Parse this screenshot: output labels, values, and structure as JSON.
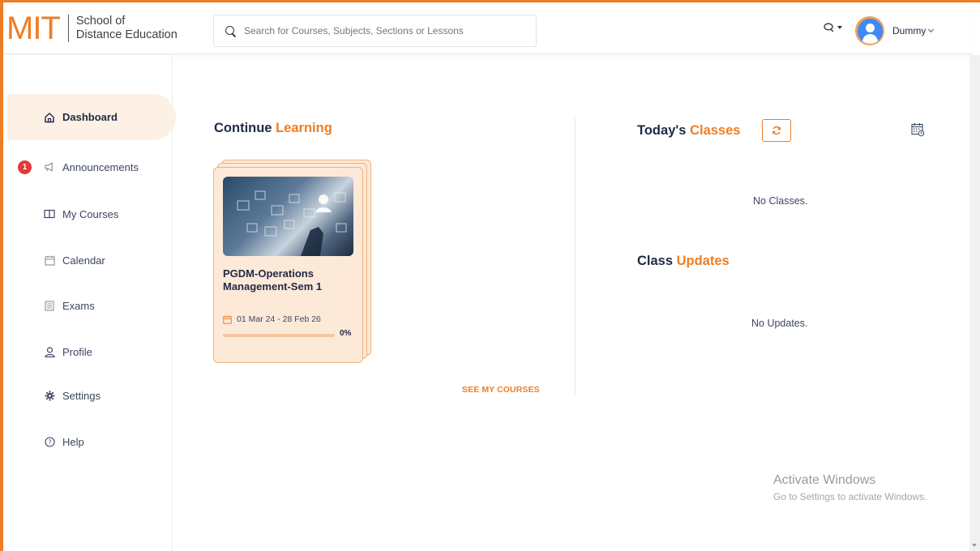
{
  "header": {
    "logo_main": "MIT",
    "logo_line1": "School of",
    "logo_line2": "Distance Education",
    "search_placeholder": "Search for Courses, Subjects, Sections or Lessons",
    "user_name": "Dummy"
  },
  "sidebar": {
    "items": [
      {
        "label": "Dashboard",
        "icon": "home-icon",
        "active": true
      },
      {
        "label": "Announcements",
        "icon": "megaphone-icon",
        "badge": "1"
      },
      {
        "label": "My Courses",
        "icon": "book-icon"
      },
      {
        "label": "Calendar",
        "icon": "calendar-icon"
      },
      {
        "label": "Exams",
        "icon": "exam-icon"
      },
      {
        "label": "Profile",
        "icon": "user-icon"
      },
      {
        "label": "Settings",
        "icon": "gear-icon"
      },
      {
        "label": "Help",
        "icon": "help-icon"
      }
    ]
  },
  "continue_learning": {
    "title_part1": "Continue",
    "title_part2": "Learning",
    "course": {
      "title": "PGDM-Operations Management-Sem 1",
      "dates": "01 Mar 24 - 28 Feb 26",
      "progress_label": "0%",
      "progress_value": 0
    },
    "see_more_label": "SEE MY COURSES"
  },
  "todays_classes": {
    "title_part1": "Today's",
    "title_part2": "Classes",
    "empty_text": "No Classes."
  },
  "class_updates": {
    "title_part1": "Class",
    "title_part2": "Updates",
    "empty_text": "No Updates."
  },
  "watermark": {
    "title": "Activate Windows",
    "subtitle": "Go to Settings to activate Windows."
  },
  "colors": {
    "accent": "#ef7d23",
    "card_bg": "#fde9d8",
    "badge": "#e53935",
    "avatar": "#3d8af7",
    "text_dark": "#1f2a44"
  }
}
